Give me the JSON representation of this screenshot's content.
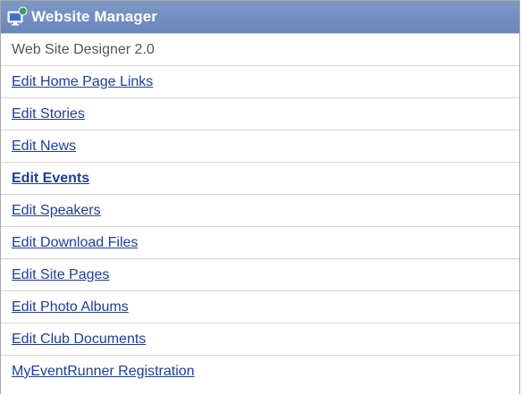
{
  "panel": {
    "title": "Website Manager",
    "icon": "monitor-globe-icon",
    "subtitle": "Web Site Designer 2.0"
  },
  "links": [
    {
      "label": "Edit Home Page Links"
    },
    {
      "label": "Edit Stories"
    },
    {
      "label": "Edit News"
    },
    {
      "label": "Edit Events",
      "active": true
    },
    {
      "label": "Edit Speakers"
    },
    {
      "label": "Edit Download Files"
    },
    {
      "label": "Edit Site Pages"
    },
    {
      "label": "Edit Photo Albums"
    },
    {
      "label": "Edit Club Documents"
    },
    {
      "label": "MyEventRunner Registration"
    }
  ],
  "colors": {
    "header": "#6f8bc1",
    "link": "#1c3f95"
  }
}
